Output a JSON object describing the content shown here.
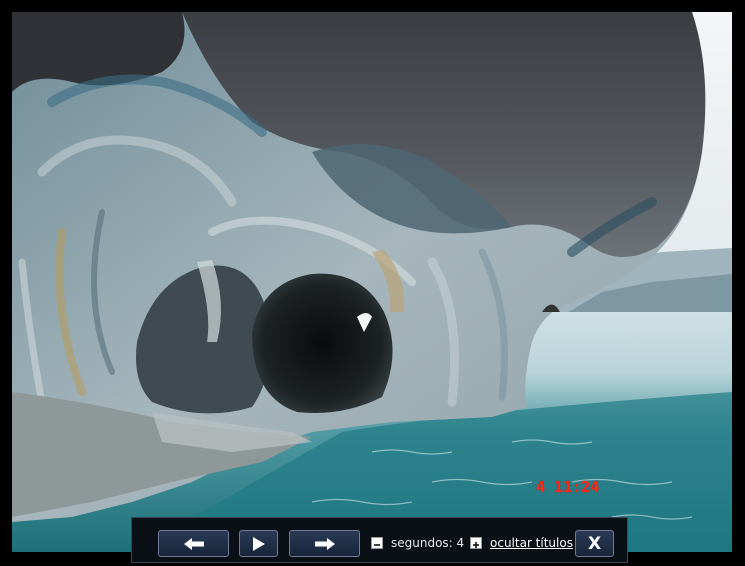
{
  "photo": {
    "subject": "marble-cave",
    "timestamp": "4 11:24"
  },
  "controls": {
    "prev_icon": "arrow-left-icon",
    "play_icon": "play-icon",
    "next_icon": "arrow-right-icon",
    "minus_icon": "minus-icon",
    "plus_icon": "plus-icon",
    "seconds_label": "segundos: 4",
    "hide_titles_label": "ocultar títulos",
    "close_label": "X"
  },
  "colors": {
    "timestamp": "#ff2a1a",
    "control_bar": "#0b0f16",
    "button_bg": "#1f2e47",
    "button_border": "#6c7a95"
  }
}
